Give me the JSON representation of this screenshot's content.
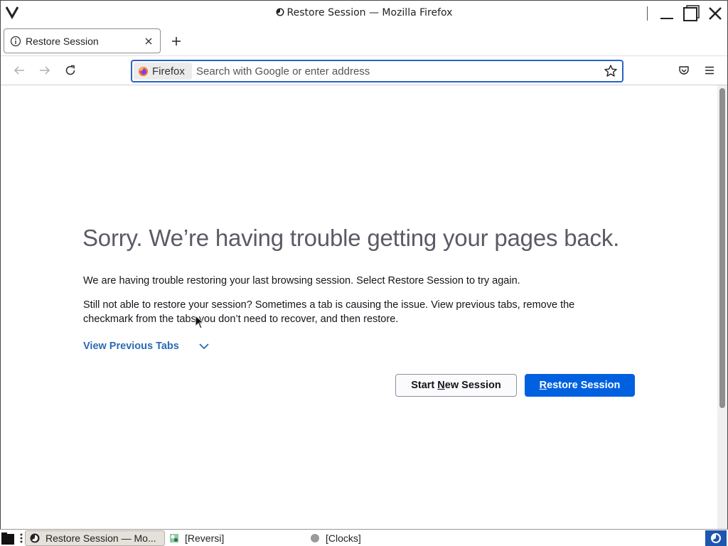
{
  "window": {
    "title": "Restore Session — Mozilla Firefox"
  },
  "tabs": [
    {
      "label": "Restore Session"
    }
  ],
  "urlbar": {
    "identity_label": "Firefox",
    "placeholder": "Search with Google or enter address"
  },
  "page": {
    "heading": "Sorry. We’re having trouble getting your pages back.",
    "para1": "We are having trouble restoring your last browsing session. Select Restore Session to try again.",
    "para2": "Still not able to restore your session? Sometimes a tab is causing the issue. View previous tabs, remove the checkmark from the tabs you don’t need to recover, and then restore.",
    "view_previous_label": "View Previous Tabs",
    "start_new_pre": "Start ",
    "start_new_accel": "N",
    "start_new_post": "ew Session",
    "restore_accel": "R",
    "restore_post": "estore Session"
  },
  "taskbar": {
    "items": [
      {
        "label": "Restore Session — Mo..."
      },
      {
        "label": "[Reversi]"
      },
      {
        "label": "[Clocks]"
      }
    ]
  },
  "colors": {
    "accent": "#0061e0",
    "link": "#2b6ab5",
    "urlbar_focus": "#2b63c4",
    "heading": "#5b5b66"
  }
}
